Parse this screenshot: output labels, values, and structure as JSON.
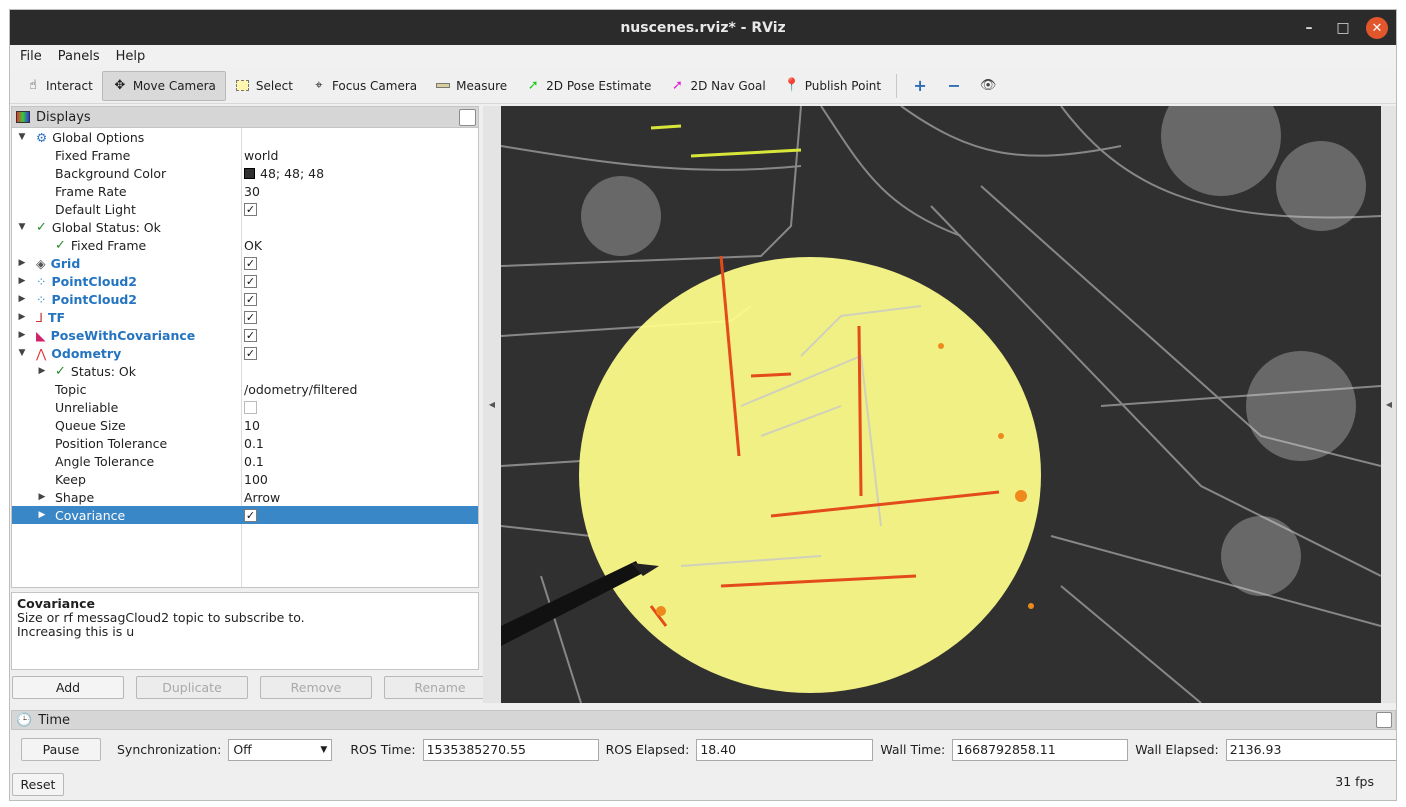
{
  "window": {
    "title": "nuscenes.rviz* - RViz"
  },
  "menu": [
    "File",
    "Panels",
    "Help"
  ],
  "toolbar": {
    "interact": "Interact",
    "move_camera": "Move Camera",
    "select": "Select",
    "focus_camera": "Focus Camera",
    "measure": "Measure",
    "pose_estimate": "2D Pose Estimate",
    "nav_goal": "2D Nav Goal",
    "publish_point": "Publish Point"
  },
  "displays": {
    "title": "Displays",
    "rows": {
      "global_options": "Global Options",
      "fixed_frame": "Fixed Frame",
      "fixed_frame_val": "world",
      "background_color": "Background Color",
      "background_color_val": "48; 48; 48",
      "frame_rate": "Frame Rate",
      "frame_rate_val": "30",
      "default_light": "Default Light",
      "global_status": "Global Status: Ok",
      "gs_fixed_frame": "Fixed Frame",
      "gs_fixed_frame_val": "OK",
      "grid": "Grid",
      "pc1": "PointCloud2",
      "pc2": "PointCloud2",
      "tf": "TF",
      "pose": "PoseWithCovariance",
      "odometry": "Odometry",
      "status": "Status: Ok",
      "topic": "Topic",
      "topic_val": "/odometry/filtered",
      "unreliable": "Unreliable",
      "queue_size": "Queue Size",
      "queue_size_val": "10",
      "position_tolerance": "Position Tolerance",
      "position_tolerance_val": "0.1",
      "angle_tolerance": "Angle Tolerance",
      "angle_tolerance_val": "0.1",
      "keep": "Keep",
      "keep_val": "100",
      "shape": "Shape",
      "shape_val": "Arrow",
      "covariance": "Covariance"
    }
  },
  "description": {
    "title": "Covariance",
    "line1": "Size or rf messagCloud2 topic to subscribe to.",
    "line2": "Increasing this is u"
  },
  "buttons": {
    "add": "Add",
    "duplicate": "Duplicate",
    "remove": "Remove",
    "rename": "Rename"
  },
  "time": {
    "title": "Time",
    "pause": "Pause",
    "sync_label": "Synchronization:",
    "sync_value": "Off",
    "ros_time_label": "ROS Time:",
    "ros_time": "1535385270.55",
    "ros_elapsed_label": "ROS Elapsed:",
    "ros_elapsed": "18.40",
    "wall_time_label": "Wall Time:",
    "wall_time": "1668792858.11",
    "wall_elapsed_label": "Wall Elapsed:",
    "wall_elapsed": "2136.93",
    "reset": "Reset",
    "fps": "31 fps"
  },
  "colors": {
    "background": "#303030",
    "selection": "#3a87c8",
    "covariance": "#ffff8c",
    "display_name": "#2474c0"
  }
}
